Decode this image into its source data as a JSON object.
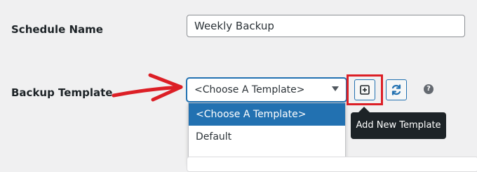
{
  "form": {
    "schedule_name_label": "Schedule Name",
    "schedule_name_value": "Weekly Backup",
    "backup_template_label": "Backup Template",
    "template_select_value": "<Choose A Template>",
    "template_options": [
      "<Choose A Template>",
      "Default"
    ],
    "add_template_tooltip": "Add New Template",
    "help_text": "?"
  },
  "icons": {
    "add": "plus-square-icon",
    "refresh": "refresh-icon",
    "annotation": "red-arrow-icon",
    "help": "question-circle-icon"
  },
  "colors": {
    "accent": "#2271b1",
    "annotation_red": "#dc1f26",
    "tooltip_bg": "#1d2327",
    "page_bg": "#f0f0f1"
  }
}
